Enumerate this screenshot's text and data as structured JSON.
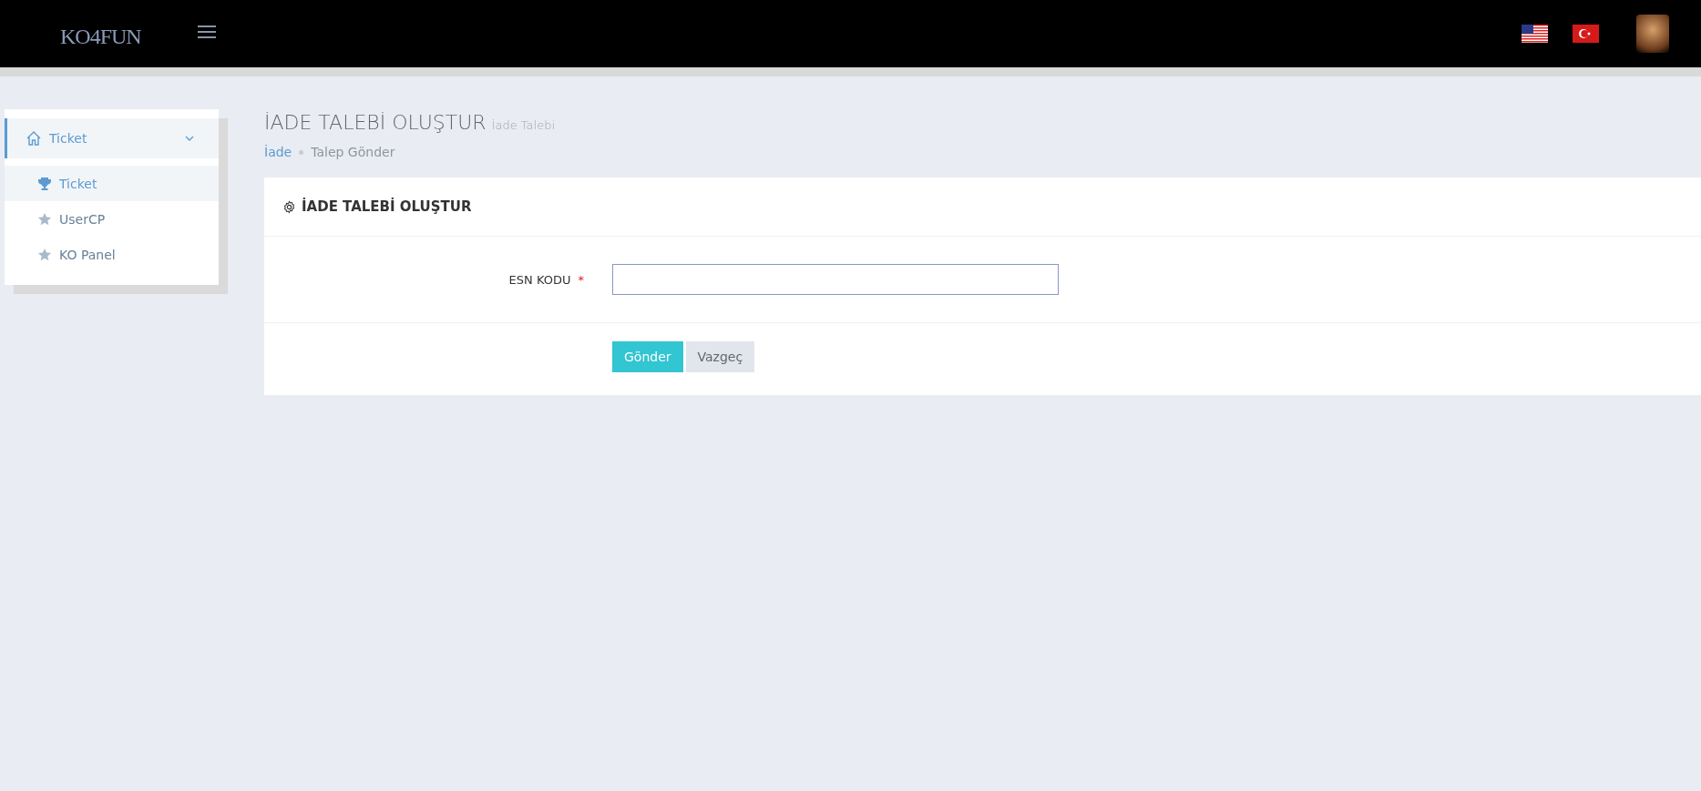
{
  "header": {
    "logo": "KO4FUN"
  },
  "sidebar": {
    "group": {
      "label": "Ticket",
      "expanded": true,
      "selected": true
    },
    "items": [
      {
        "label": "Ticket",
        "kind": "trophy",
        "selected": true
      },
      {
        "label": "UserCP",
        "kind": "star",
        "selected": false
      },
      {
        "label": "KO Panel",
        "kind": "star",
        "selected": false
      }
    ]
  },
  "page": {
    "title": "İADE TALEBİ OLUŞTUR",
    "subtitle": "İade Talebi",
    "breadcrumb": [
      {
        "label": "İade",
        "kind": "link"
      },
      {
        "label": "Talep Gönder",
        "kind": "current"
      }
    ]
  },
  "card": {
    "title": "İADE TALEBİ OLUŞTUR",
    "field": {
      "label": "ESN KODU",
      "required_mark": "*",
      "focused": true
    },
    "buttons": [
      {
        "label": "Gönder",
        "kind": "primary"
      },
      {
        "label": "Vazgeç",
        "kind": "default"
      }
    ]
  }
}
